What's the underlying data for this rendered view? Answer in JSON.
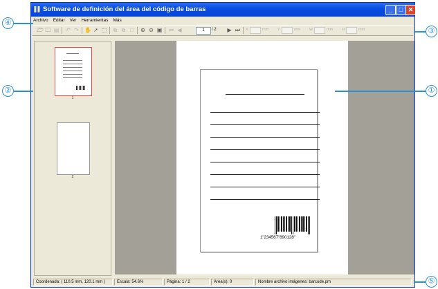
{
  "window": {
    "title": "Software de definición del área del código de barras"
  },
  "menu": {
    "items": [
      "Archivo",
      "Editar",
      "Ver",
      "Herramientas",
      "Más"
    ]
  },
  "toolbar": {
    "page_value": "1",
    "page_total": "/ 2",
    "unit_x": "X",
    "unit_mm1": "mm",
    "unit_y": "Y",
    "unit_mm2": "mm",
    "unit_w": "W",
    "unit_mm3": "mm",
    "unit_h": "H",
    "unit_mm4": "mm"
  },
  "thumbnails": [
    {
      "number": "1",
      "selected": true
    },
    {
      "number": "2",
      "selected": false
    }
  ],
  "document": {
    "barcode_number": "1\"234567\"890128\""
  },
  "status": {
    "coordinates": "Coordenada: ( 110.5 mm, 120.1 mm )",
    "scale": "Escala: 54.6%",
    "page": "Página: 1 / 2",
    "areas": "Área(s): 0",
    "image_file": "Nombre archivo imágenes: barcode.pm"
  },
  "callouts": {
    "c1": "①",
    "c2": "②",
    "c3": "③",
    "c4": "④",
    "c5": "⑤"
  },
  "colors": {
    "callout": "#2b8fd6",
    "titlebar": "#0a4ee2",
    "selected_thumb": "#e5484d"
  }
}
